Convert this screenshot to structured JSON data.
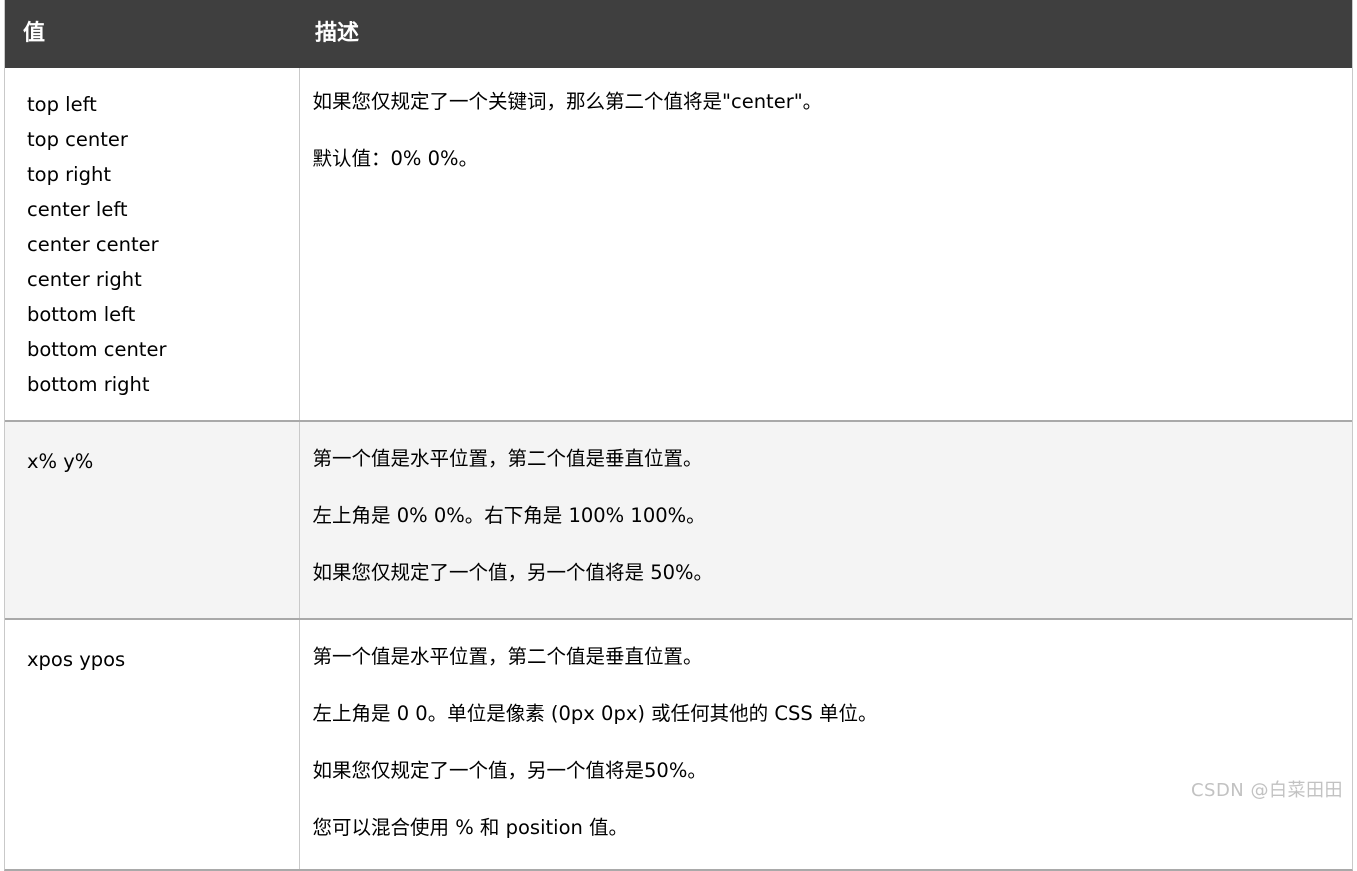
{
  "table": {
    "header": {
      "value_label": "值",
      "description_label": "描述"
    },
    "rows": [
      {
        "id": "keywords",
        "values": [
          "top left",
          "top center",
          "top right",
          "center left",
          "center center",
          "center right",
          "bottom left",
          "bottom center",
          "bottom right"
        ],
        "descriptions": [
          "如果您仅规定了一个关键词，那么第二个值将是\"center\"。",
          "默认值：0% 0%。"
        ]
      },
      {
        "id": "percent",
        "value": "x% y%",
        "descriptions": [
          "第一个值是水平位置，第二个值是垂直位置。",
          "左上角是 0% 0%。右下角是 100% 100%。",
          "如果您仅规定了一个值，另一个值将是 50%。"
        ]
      },
      {
        "id": "position",
        "value": "xpos ypos",
        "descriptions": [
          "第一个值是水平位置，第二个值是垂直位置。",
          "左上角是 0 0。单位是像素 (0px 0px) 或任何其他的 CSS 单位。",
          "如果您仅规定了一个值，另一个值将是50%。",
          "您可以混合使用 % 和 position 值。"
        ]
      }
    ]
  },
  "watermark": {
    "text": "CSDN @白菜田田"
  },
  "colors": {
    "header_background": "#3f3f3f",
    "header_text": "#ffffff",
    "row_stripe": "#f4f4f4",
    "row_plain": "#ffffff",
    "border": "#c9c9c9",
    "row_divider": "#a9a9a9",
    "body_text": "#000000",
    "watermark_text": "#c2c2c2"
  }
}
